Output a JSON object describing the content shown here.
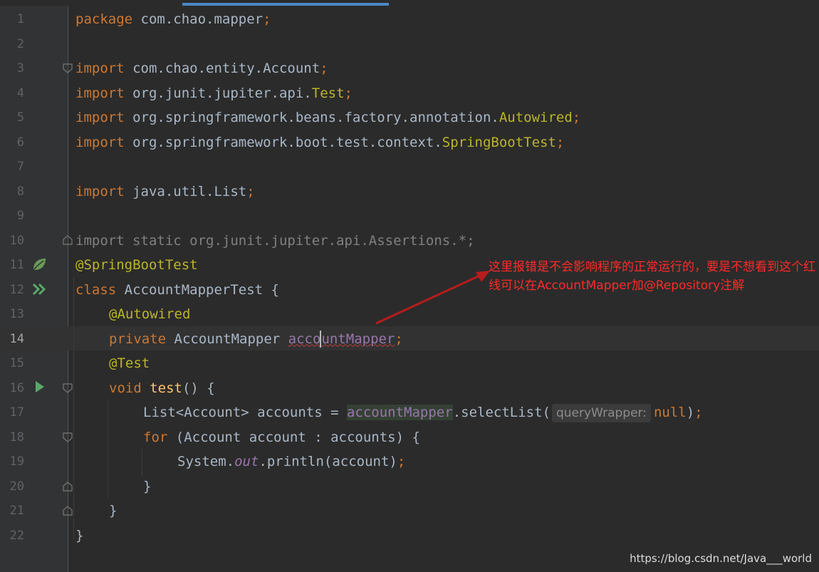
{
  "editor": {
    "lines": [
      {
        "n": "1"
      },
      {
        "n": "2"
      },
      {
        "n": "3"
      },
      {
        "n": "4"
      },
      {
        "n": "5"
      },
      {
        "n": "6"
      },
      {
        "n": "7"
      },
      {
        "n": "8"
      },
      {
        "n": "9"
      },
      {
        "n": "10"
      },
      {
        "n": "11"
      },
      {
        "n": "12"
      },
      {
        "n": "13"
      },
      {
        "n": "14"
      },
      {
        "n": "15"
      },
      {
        "n": "16"
      },
      {
        "n": "17"
      },
      {
        "n": "18"
      },
      {
        "n": "19"
      },
      {
        "n": "20"
      },
      {
        "n": "21"
      },
      {
        "n": "22"
      }
    ],
    "current_line": "14",
    "code": {
      "l1": {
        "kw": "package",
        "rest": " com.chao.mapper",
        "semi": ";"
      },
      "l3": {
        "kw": "import",
        "pre": " com.chao.entity.",
        "cls": "Account",
        "semi": ";"
      },
      "l4": {
        "kw": "import",
        "pre": " org.junit.jupiter.api.",
        "cls": "Test",
        "semi": ";"
      },
      "l5": {
        "kw": "import",
        "pre": " org.springframework.beans.factory.annotation.",
        "cls": "Autowired",
        "semi": ";"
      },
      "l6": {
        "kw": "import",
        "pre": " org.springframework.boot.test.context.",
        "cls": "SpringBootTest",
        "semi": ";"
      },
      "l8": {
        "kw": "import",
        "pre": " java.util.",
        "cls": "List",
        "semi": ";"
      },
      "l10": {
        "text": "import static org.junit.jupiter.api.Assertions.*;"
      },
      "l11": {
        "ann": "@SpringBootTest"
      },
      "l12": {
        "kw": "class",
        "rest": " AccountMapperTest {"
      },
      "l13": {
        "ann": "@Autowired"
      },
      "l14": {
        "kw": "private",
        "type": " AccountMapper ",
        "f1": "acco",
        "f2": "untMapper",
        "semi": ";"
      },
      "l15": {
        "ann": "@Test"
      },
      "l16": {
        "kw": "void",
        "sp": " ",
        "fn": "test",
        "rest": "() {"
      },
      "l17": {
        "pre": "List<Account> accounts = ",
        "fld": "accountMapper",
        "call": ".selectList(",
        "hint": "queryWrapper:",
        "null_kw": "null",
        "end": ")",
        "semi": ";"
      },
      "l18": {
        "kw": "for",
        "rest": " (Account account : accounts) {"
      },
      "l19": {
        "pre": "System.",
        "fld": "out",
        "call": ".println(account)",
        "semi": ";"
      },
      "l20": {
        "text": "}"
      },
      "l21": {
        "text": "}"
      },
      "l22": {
        "text": "}"
      }
    }
  },
  "gutter_icons": {
    "l11": "spring-bean-leaf-icon",
    "l12": "run-test-class-icon",
    "l16": "run-test-method-icon"
  },
  "annotation_note": {
    "text": "这里报错是不会影响程序的正常运行的，要是不想看到这个红线可以在AccountMapper加@Repository注解",
    "color": "#ff2a2a"
  },
  "watermark": "https://blog.csdn.net/Java___world",
  "colors": {
    "background": "#2b2b2b",
    "gutter": "#313335",
    "keyword": "#cc7832",
    "annotation": "#bbb529",
    "field": "#9876aa",
    "method": "#ffc66d",
    "text": "#a9b7c6",
    "tab_indicator": "#4a88c7"
  }
}
